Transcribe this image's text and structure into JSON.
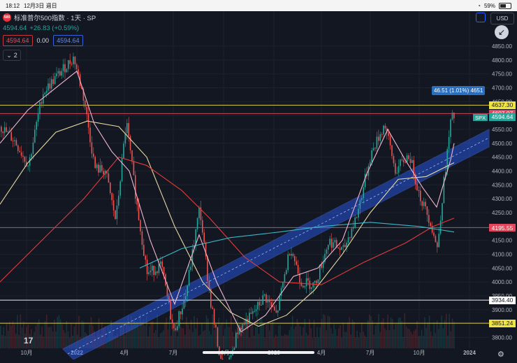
{
  "status_bar": {
    "time": "18:12",
    "date": "12月3日 週日",
    "battery": "59%",
    "battery_level": 0.59
  },
  "legend": {
    "symbol_badge": "500",
    "title": "标准普尔500指数 · 1天 · SP",
    "last": "4594.64",
    "change": "+26.83 (+0.59%)",
    "box_red": "4594.64",
    "box_mid": "0.00",
    "box_blue": "4594.64",
    "indicators_count": "2"
  },
  "currency": "USD",
  "measure_label": "46.51 (1.01%) 4651",
  "symbol_tag": "SPX",
  "price_labels": [
    {
      "value": "4637.30",
      "price": 4637.3,
      "color": "#f0e442"
    },
    {
      "value": "4607.07",
      "price": 4607.07,
      "color": "#e2475d"
    },
    {
      "value": "4594.64",
      "price": 4594.64,
      "color": "#26a69a"
    },
    {
      "value": "4195.55",
      "price": 4195.55,
      "color": "#e2475d"
    },
    {
      "value": "3934.40",
      "price": 3934.4,
      "color": "#ffffff"
    },
    {
      "value": "3851.24",
      "price": 3851.24,
      "color": "#f0e442"
    }
  ],
  "x_axis": [
    "10月",
    "2022",
    "4月",
    "7月",
    "10月",
    "2023",
    "4月",
    "7月",
    "10月",
    "2024"
  ],
  "y_axis": [
    "4850.00",
    "4800.00",
    "4750.00",
    "4700.00",
    "4650.00",
    "4600.00",
    "4550.00",
    "4500.00",
    "4450.00",
    "4400.00",
    "4350.00",
    "4300.00",
    "4250.00",
    "4200.00",
    "4150.00",
    "4100.00",
    "4050.00",
    "4000.00",
    "3950.00",
    "3900.00",
    "3850.00",
    "3800.00"
  ],
  "tv_logo": "17",
  "colors": {
    "up": "#26a69a",
    "down": "#ef5350",
    "channel": "#2962ff",
    "bg": "#131722"
  }
}
